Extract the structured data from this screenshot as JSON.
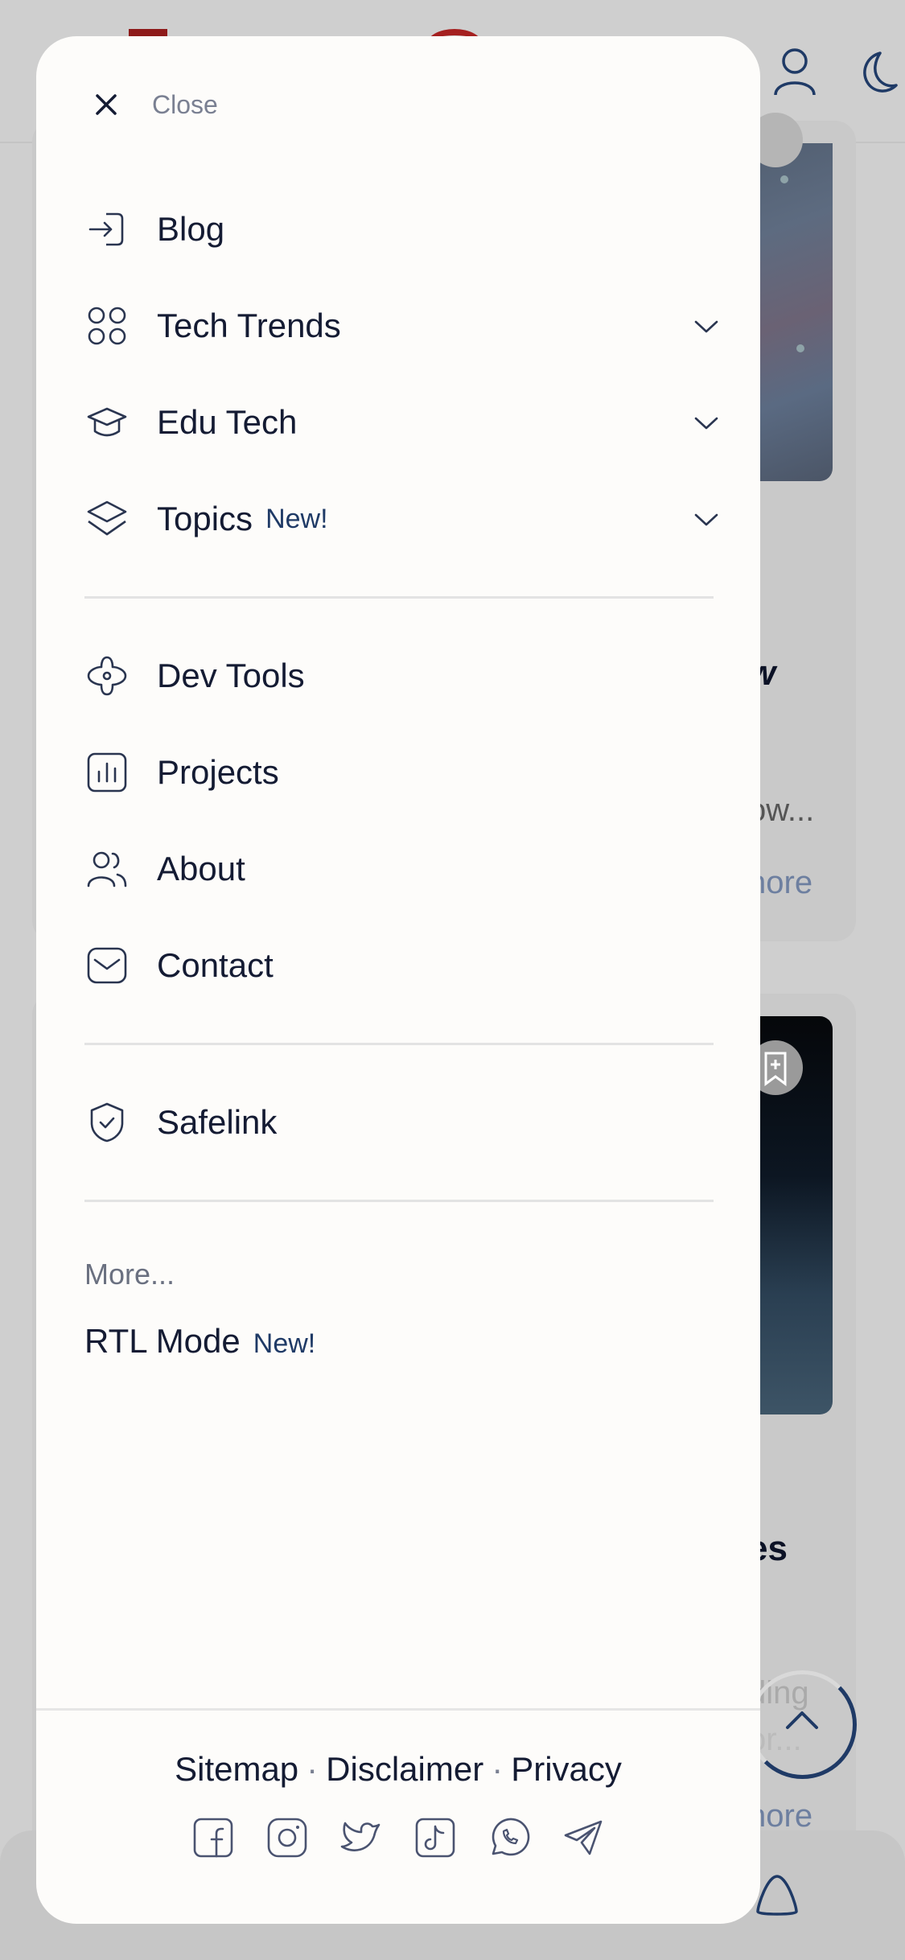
{
  "drawer": {
    "close_label": "Close",
    "nav_group_1": [
      {
        "label": "Blog",
        "badge": "",
        "icon": "login-icon",
        "has_chevron": false
      },
      {
        "label": "Tech Trends",
        "badge": "",
        "icon": "grid-circles-icon",
        "has_chevron": true
      },
      {
        "label": "Edu Tech",
        "badge": "",
        "icon": "graduation-cap-icon",
        "has_chevron": true
      },
      {
        "label": "Topics",
        "badge": "New!",
        "icon": "layers-icon",
        "has_chevron": true
      }
    ],
    "nav_group_2": [
      {
        "label": "Dev Tools",
        "icon": "puzzle-icon"
      },
      {
        "label": "Projects",
        "icon": "chart-bars-icon"
      },
      {
        "label": "About",
        "icon": "users-icon"
      },
      {
        "label": "Contact",
        "icon": "mail-icon"
      }
    ],
    "nav_group_3": [
      {
        "label": "Safelink",
        "icon": "shield-check-icon"
      }
    ],
    "more_label": "More...",
    "rtl": {
      "label": "RTL Mode",
      "badge": "New!"
    },
    "footer": {
      "links": [
        "Sitemap",
        "Disclaimer",
        "Privacy"
      ],
      "separator": "·",
      "socials": [
        "facebook-icon",
        "instagram-icon",
        "twitter-icon",
        "tiktok-icon",
        "whatsapp-icon",
        "telegram-icon"
      ]
    }
  },
  "background": {
    "card1_title_fragment": "w",
    "card1_text_fragment_1": ":",
    "card1_text_fragment_2": "ow...",
    "card1_more": "nore",
    "card2_title_fragment": "es",
    "card2_text_fragment_1": "ding",
    "card2_text_fragment_2": "or...",
    "card2_more": "nore"
  },
  "colors": {
    "drawer_bg": "#fdfcfa",
    "text": "#141b33",
    "accent": "#1f3a66",
    "muted": "#7a8092",
    "overlay": "#cfcfcf"
  }
}
